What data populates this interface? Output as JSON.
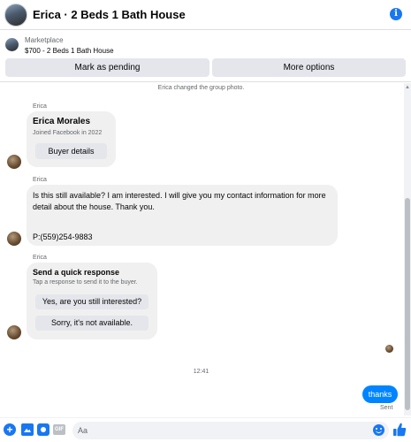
{
  "header": {
    "title": "Erica · 2 Beds 1 Bath House",
    "info_glyph": "i"
  },
  "marketplace": {
    "label": "Marketplace",
    "listing": "$700 - 2 Beds 1 Bath House",
    "pending_button": "Mark as pending",
    "more_button": "More options"
  },
  "chat": {
    "system_message": "Erica changed the group photo.",
    "card1": {
      "sender": "Erica",
      "name": "Erica Morales",
      "joined": "Joined Facebook in 2022",
      "button": "Buyer details"
    },
    "msg2": {
      "sender": "Erica",
      "text": "Is this still available? I am interested. I will give you my contact information for more detail about the house. Thank you.",
      "phone": "P:(559)254-9883"
    },
    "card3": {
      "sender": "Erica",
      "heading": "Send a quick response",
      "subtext": "Tap a response to send it to the buyer.",
      "option1": "Yes, are you still interested?",
      "option2": "Sorry, it's not available."
    },
    "timestamp": "12:41",
    "outgoing": "thanks",
    "status": "Sent"
  },
  "composer": {
    "placeholder": "Aa",
    "gif_label": "GIF"
  },
  "colors": {
    "accent": "#1877f2",
    "outgoing_bubble": "#0084ff",
    "incoming_bubble": "#f0f0f0",
    "button_bg": "#e4e6eb"
  }
}
